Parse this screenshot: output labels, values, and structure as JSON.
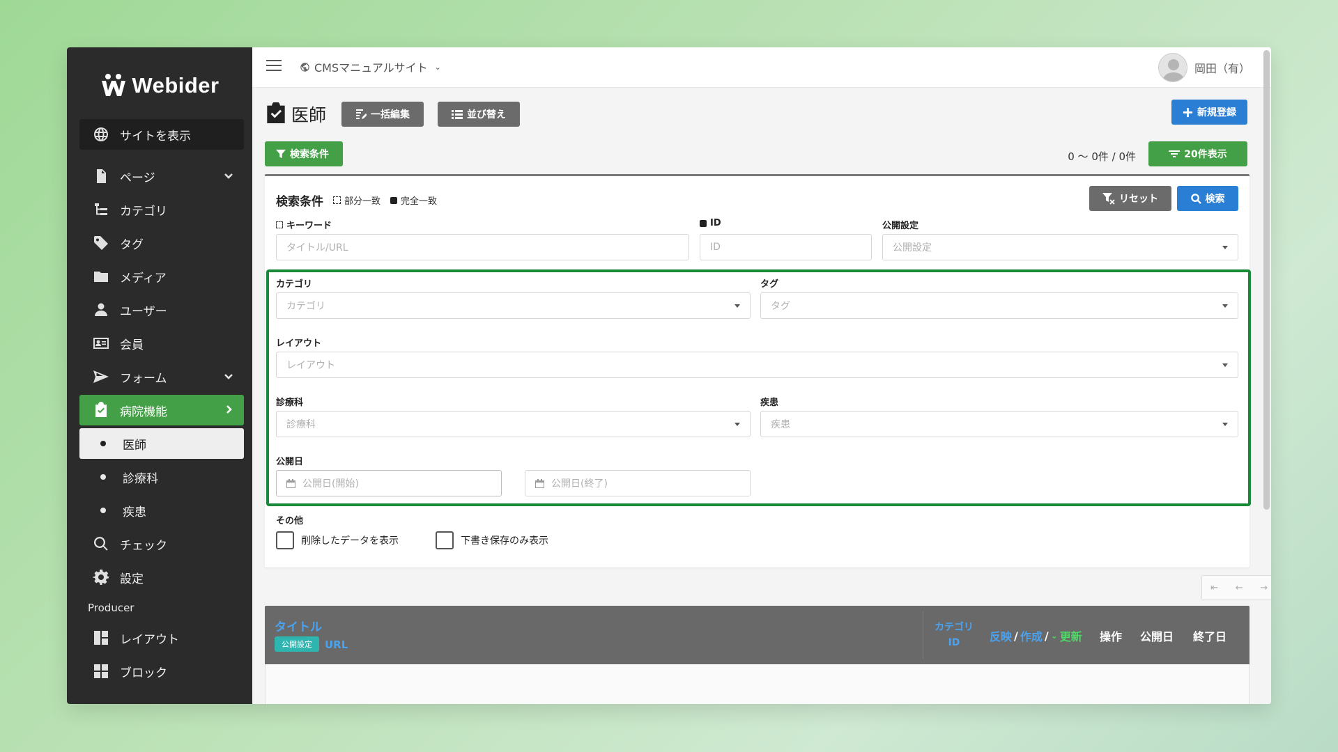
{
  "sidebar": {
    "logo_text": "Webider",
    "items": [
      {
        "label": "サイトを表示",
        "icon": "globe-icon"
      },
      {
        "label": "ページ",
        "icon": "document-icon"
      },
      {
        "label": "カテゴリ",
        "icon": "hierarchy-icon"
      },
      {
        "label": "タグ",
        "icon": "tag-icon"
      },
      {
        "label": "メディア",
        "icon": "folder-icon"
      },
      {
        "label": "ユーザー",
        "icon": "user-icon"
      },
      {
        "label": "会員",
        "icon": "id-card-icon"
      },
      {
        "label": "フォーム",
        "icon": "paper-plane-icon"
      },
      {
        "label": "病院機能",
        "icon": "clipboard-check-icon"
      },
      {
        "label": "医師"
      },
      {
        "label": "診療科"
      },
      {
        "label": "疾患"
      },
      {
        "label": "チェック",
        "icon": "search-icon"
      },
      {
        "label": "設定",
        "icon": "gear-icon"
      },
      {
        "label": "レイアウト",
        "icon": "layout-icon"
      },
      {
        "label": "ブロック",
        "icon": "grid-icon"
      }
    ],
    "section_producer": "Producer"
  },
  "topbar": {
    "site_name": "CMSマニュアルサイト",
    "user_name": "岡田（有）"
  },
  "page": {
    "title": "医師",
    "bulk_edit": "一括編集",
    "sort": "並び替え",
    "new": "新規登録",
    "filter_toggle": "検索条件",
    "count": "0 〜 0件 / 0件",
    "per_page": "20件表示"
  },
  "search": {
    "title": "検索条件",
    "partial": "部分一致",
    "exact": "完全一致",
    "reset": "リセット",
    "search": "検索",
    "keyword_label": "キーワード",
    "keyword_placeholder": "タイトル/URL",
    "id_label": "ID",
    "id_placeholder": "ID",
    "publish_label": "公開設定",
    "publish_placeholder": "公開設定",
    "category_label": "カテゴリ",
    "category_placeholder": "カテゴリ",
    "tag_label": "タグ",
    "tag_placeholder": "タグ",
    "layout_label": "レイアウト",
    "layout_placeholder": "レイアウト",
    "dept_label": "診療科",
    "dept_placeholder": "診療科",
    "disease_label": "疾患",
    "disease_placeholder": "疾患",
    "date_label": "公開日",
    "date_start": "公開日(開始)",
    "date_end": "公開日(終了)",
    "other_label": "その他",
    "show_deleted": "削除したデータを表示",
    "drafts_only": "下書き保存のみ表示"
  },
  "pager": [
    "⇤",
    "←",
    "→",
    "⇥"
  ],
  "table": {
    "title": "タイトル",
    "badge": "公開設定",
    "url": "URL",
    "category": "カテゴリ",
    "id": "ID",
    "reflect": "反映",
    "create": "作成",
    "slash": "/",
    "update_mark": "⌄",
    "update": "更新",
    "ops": "操作",
    "pub_date": "公開日",
    "end_date": "終了日"
  }
}
